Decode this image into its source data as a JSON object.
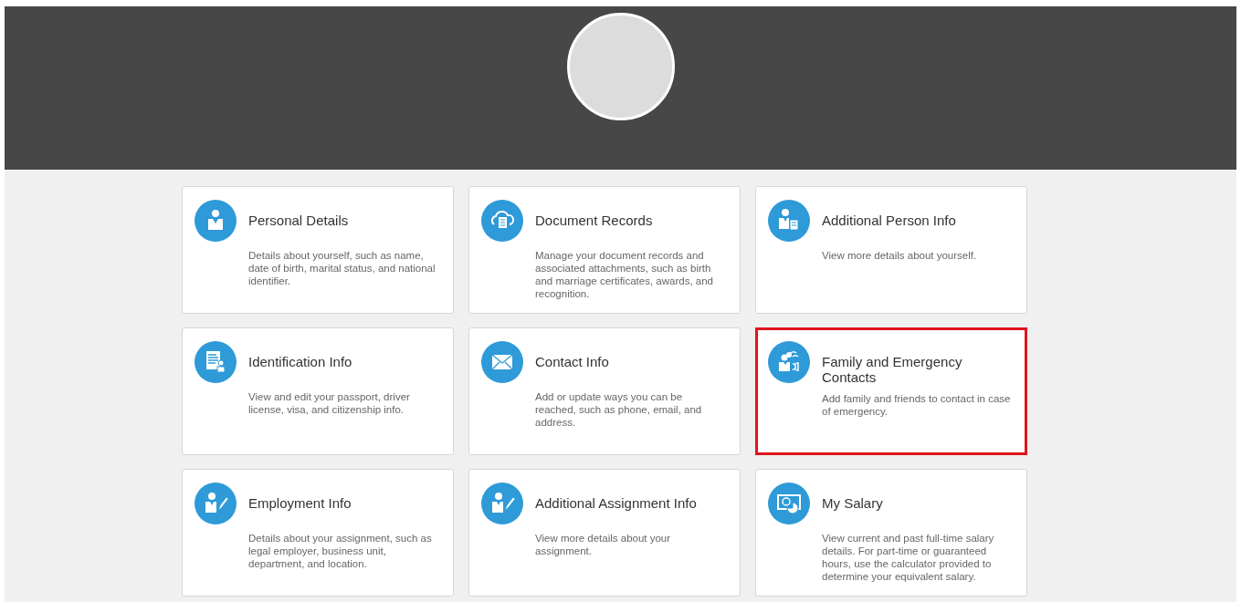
{
  "cards": [
    {
      "kind": "person",
      "title": "Personal Details",
      "description": "Details about yourself, such as name, date of birth, marital status, and national identifier.",
      "highlighted": false
    },
    {
      "kind": "cloud-document",
      "title": "Document Records",
      "description": "Manage your document records and associated attachments, such as birth and marriage certificates, awards, and recognition.",
      "highlighted": false
    },
    {
      "kind": "person-document",
      "title": "Additional Person Info",
      "description": "View more details about yourself.",
      "highlighted": false
    },
    {
      "kind": "id-document",
      "title": "Identification Info",
      "description": "View and edit your passport, driver license, visa, and citizenship info.",
      "highlighted": false
    },
    {
      "kind": "envelope",
      "title": "Contact Info",
      "description": "Add or update ways you can be reached, such as phone, email, and address.",
      "highlighted": false
    },
    {
      "kind": "family",
      "title": "Family and Emergency Contacts",
      "description": "Add family and friends to contact in case of emergency.",
      "highlighted": true
    },
    {
      "kind": "person-pencil",
      "title": "Employment Info",
      "description": "Details about your assignment, such as legal employer, business unit, department, and location.",
      "highlighted": false
    },
    {
      "kind": "person-pencil",
      "title": "Additional Assignment Info",
      "description": "View more details about your assignment.",
      "highlighted": false
    },
    {
      "kind": "salary",
      "title": "My Salary",
      "description": "View current and past full-time salary details. For part-time or guaranteed hours, use the calculator provided to determine your equivalent salary.",
      "highlighted": false
    }
  ]
}
